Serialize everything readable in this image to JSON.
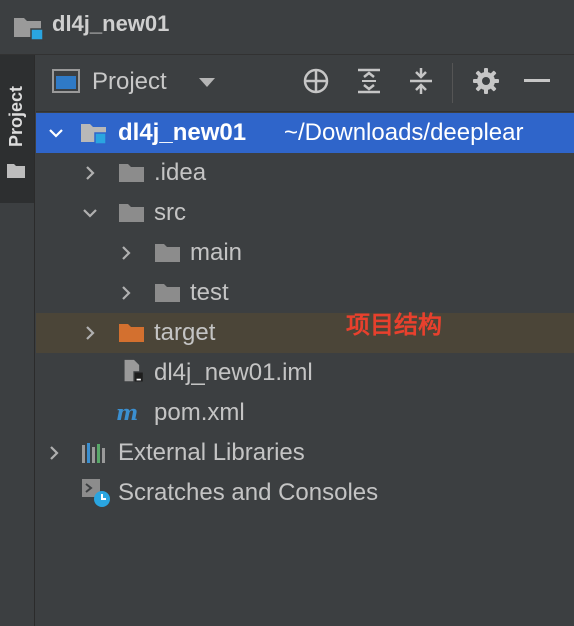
{
  "window": {
    "title": "dl4j_new01"
  },
  "left_strip": {
    "tab_label": "Project"
  },
  "panel": {
    "selector_label": "Project",
    "toolbar_icons": [
      "target-icon",
      "expand-all-icon",
      "collapse-all-icon",
      "gear-icon",
      "minimize-icon"
    ]
  },
  "tree": {
    "root": {
      "name": "dl4j_new01",
      "path": "~/Downloads/deeplear"
    },
    "items": [
      {
        "label": ".idea"
      },
      {
        "label": "src"
      },
      {
        "label": "main"
      },
      {
        "label": "test"
      },
      {
        "label": "target"
      },
      {
        "label": "dl4j_new01.iml"
      },
      {
        "label": "pom.xml"
      },
      {
        "label": "External Libraries"
      },
      {
        "label": "Scratches and Consoles"
      }
    ]
  },
  "annotation": {
    "text": "项目结构"
  },
  "colors": {
    "background": "#3c3f41",
    "selection": "#2f65ca",
    "target_row": "#4b4538",
    "folder": "#8c8c8c",
    "excluded_folder": "#d3702f",
    "annotation": "#e8402d",
    "module_badge": "#2aa5e0"
  }
}
